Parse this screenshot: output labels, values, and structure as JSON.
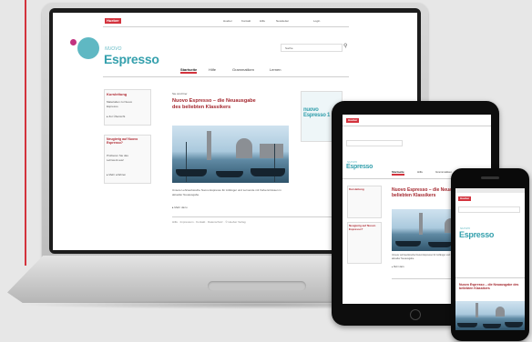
{
  "website": {
    "badge": "Hueber",
    "brand_small": "NUOVO",
    "brand_big": "Espresso",
    "top_links": [
      "Hueber",
      "Kontakt",
      "Hilfe",
      "Newsletter",
      "Login"
    ],
    "nav": [
      "Startseite",
      "Hilfe",
      "Grammatiken",
      "Lernen"
    ],
    "search_placeholder": "Suche",
    "sidebar_box1": {
      "title": "Kursleitung",
      "lines": [
        "Materialien zu Nuovo",
        "Espresso",
        "▸ Zur Übersicht"
      ]
    },
    "sidebar_box2": {
      "title": "Neugierig auf Nuovo Espresso?",
      "lines": [
        "Probieren Sie das",
        "Lehrwerk aus!",
        "▸ Mehr erfahren"
      ]
    },
    "breadcrumb": "Sie sind hier",
    "headline": "Nuovo Espresso – die Neuausgabe des beliebten Klassikers",
    "article_text": "Unsere Lehrwerksreihe Nuovo Espresso für Anfänger und Lernende mit Vorkenntnissen in aktueller Neuausgabe.",
    "more_link": "▸ Mehr dazu",
    "footer_links": "Hilfe  ·  Impressum  ·  Kontakt  ·  Datenschutz  ·  © Hueber Verlag",
    "book_title": "nuovo Espresso 1"
  },
  "colors": {
    "accent_red": "#d3333d",
    "brand_teal": "#35a0ad",
    "headline_red": "#a3252c"
  }
}
